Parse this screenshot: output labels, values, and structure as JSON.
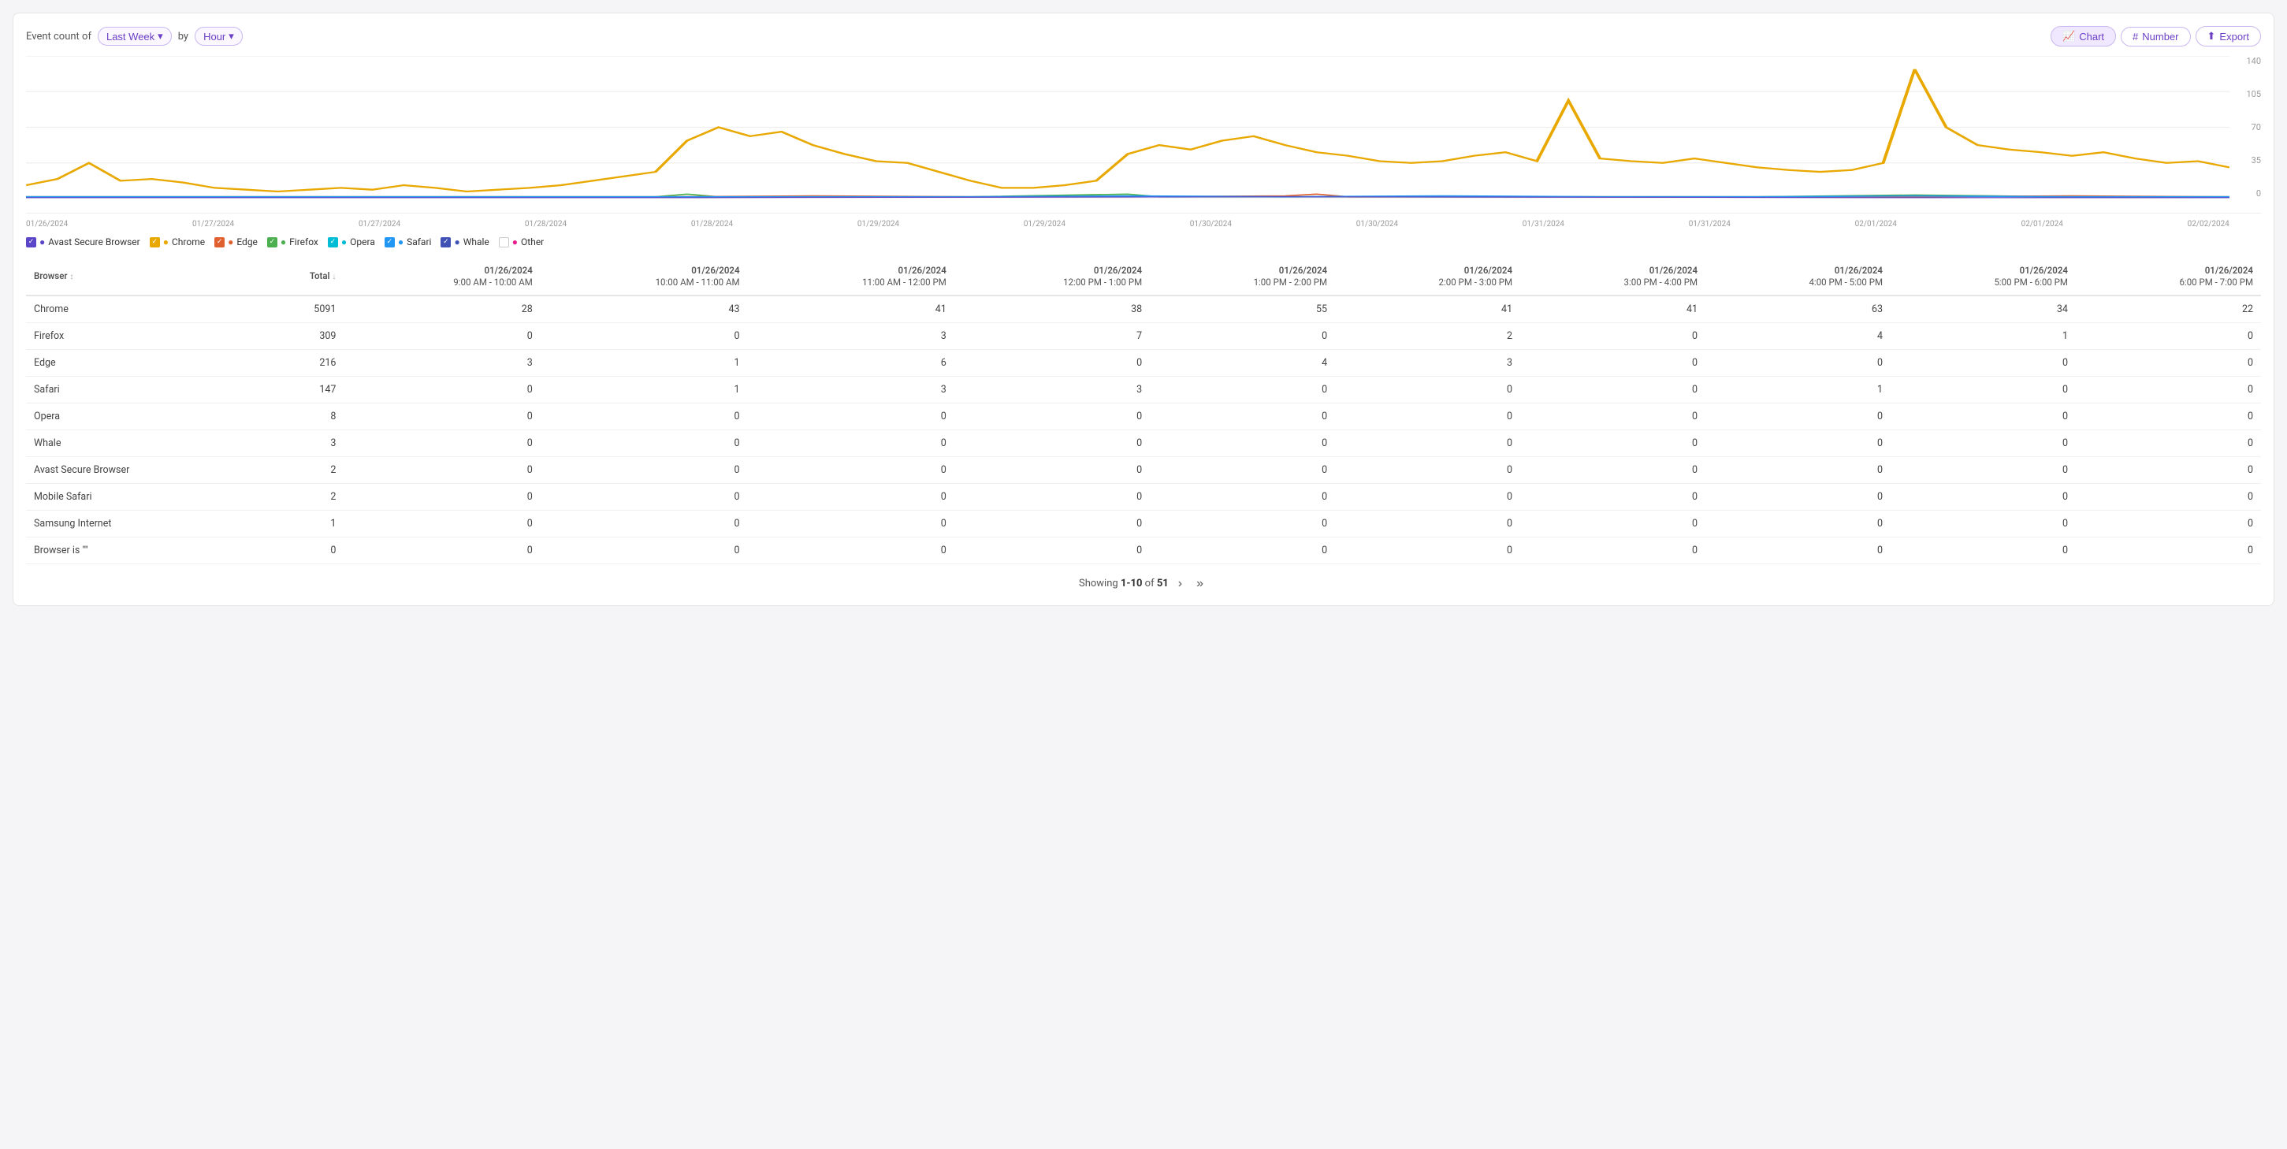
{
  "header": {
    "event_count_label": "Event count of",
    "by_label": "by",
    "time_range_label": "Last Week",
    "granularity_label": "Hour",
    "buttons": [
      {
        "id": "chart",
        "label": "Chart",
        "active": true,
        "icon": "chart-icon"
      },
      {
        "id": "number",
        "label": "Number",
        "active": false,
        "icon": "hash-icon"
      },
      {
        "id": "export",
        "label": "Export",
        "active": false,
        "icon": "export-icon"
      }
    ]
  },
  "chart": {
    "y_labels": [
      "140",
      "105",
      "70",
      "35",
      "0"
    ],
    "x_labels": [
      "01/26/2024",
      "01/27/2024",
      "01/27/2024",
      "01/28/2024",
      "01/28/2024",
      "01/29/2024",
      "01/29/2024",
      "01/30/2024",
      "01/30/2024",
      "01/31/2024",
      "01/31/2024",
      "02/01/2024",
      "02/01/2024",
      "02/02/2024"
    ]
  },
  "legend": [
    {
      "label": "Avast Secure Browser",
      "color": "#5b45c8",
      "checked": true
    },
    {
      "label": "Chrome",
      "color": "#e8a800",
      "checked": true
    },
    {
      "label": "Edge",
      "color": "#e06030",
      "checked": true
    },
    {
      "label": "Firefox",
      "color": "#4caf50",
      "checked": true
    },
    {
      "label": "Opera",
      "color": "#00bcd4",
      "checked": true
    },
    {
      "label": "Safari",
      "color": "#2196f3",
      "checked": true
    },
    {
      "label": "Whale",
      "color": "#3f51b5",
      "checked": true
    },
    {
      "label": "Other",
      "color": "#e91e8c",
      "checked": false
    }
  ],
  "table": {
    "columns": [
      {
        "id": "browser",
        "label": "Browser",
        "sortable": true
      },
      {
        "id": "total",
        "label": "Total",
        "sortable": true
      },
      {
        "id": "col1",
        "label": "01/26/2024\n9:00 AM - 10:00 AM"
      },
      {
        "id": "col2",
        "label": "01/26/2024\n10:00 AM - 11:00 AM"
      },
      {
        "id": "col3",
        "label": "01/26/2024\n11:00 AM - 12:00 PM"
      },
      {
        "id": "col4",
        "label": "01/26/2024\n12:00 PM - 1:00 PM"
      },
      {
        "id": "col5",
        "label": "01/26/2024\n1:00 PM - 2:00 PM"
      },
      {
        "id": "col6",
        "label": "01/26/2024\n2:00 PM - 3:00 PM"
      },
      {
        "id": "col7",
        "label": "01/26/2024\n3:00 PM - 4:00 PM"
      },
      {
        "id": "col8",
        "label": "01/26/2024\n4:00 PM - 5:00 PM"
      },
      {
        "id": "col9",
        "label": "01/26/2024\n5:00 PM - 6:00 PM"
      },
      {
        "id": "col10",
        "label": "01/26/2024\n6:00 PM - 7:00 PM"
      }
    ],
    "rows": [
      {
        "browser": "Chrome",
        "total": 5091,
        "values": [
          28,
          43,
          41,
          38,
          55,
          41,
          41,
          63,
          34,
          22
        ]
      },
      {
        "browser": "Firefox",
        "total": 309,
        "values": [
          0,
          0,
          3,
          7,
          0,
          2,
          0,
          4,
          1,
          0
        ]
      },
      {
        "browser": "Edge",
        "total": 216,
        "values": [
          3,
          1,
          6,
          0,
          4,
          3,
          0,
          0,
          0,
          0
        ]
      },
      {
        "browser": "Safari",
        "total": 147,
        "values": [
          0,
          1,
          3,
          3,
          0,
          0,
          0,
          1,
          0,
          0
        ]
      },
      {
        "browser": "Opera",
        "total": 8,
        "values": [
          0,
          0,
          0,
          0,
          0,
          0,
          0,
          0,
          0,
          0
        ]
      },
      {
        "browser": "Whale",
        "total": 3,
        "values": [
          0,
          0,
          0,
          0,
          0,
          0,
          0,
          0,
          0,
          0
        ]
      },
      {
        "browser": "Avast Secure Browser",
        "total": 2,
        "values": [
          0,
          0,
          0,
          0,
          0,
          0,
          0,
          0,
          0,
          0
        ]
      },
      {
        "browser": "Mobile Safari",
        "total": 2,
        "values": [
          0,
          0,
          0,
          0,
          0,
          0,
          0,
          0,
          0,
          0
        ]
      },
      {
        "browser": "Samsung Internet",
        "total": 1,
        "values": [
          0,
          0,
          0,
          0,
          0,
          0,
          0,
          0,
          0,
          0
        ]
      },
      {
        "browser": "Browser is \"\"",
        "total": 0,
        "values": [
          0,
          0,
          0,
          0,
          0,
          0,
          0,
          0,
          0,
          0
        ]
      }
    ]
  },
  "pagination": {
    "showing_text": "Showing ",
    "range": "1-10",
    "of_text": " of ",
    "total": "51"
  }
}
